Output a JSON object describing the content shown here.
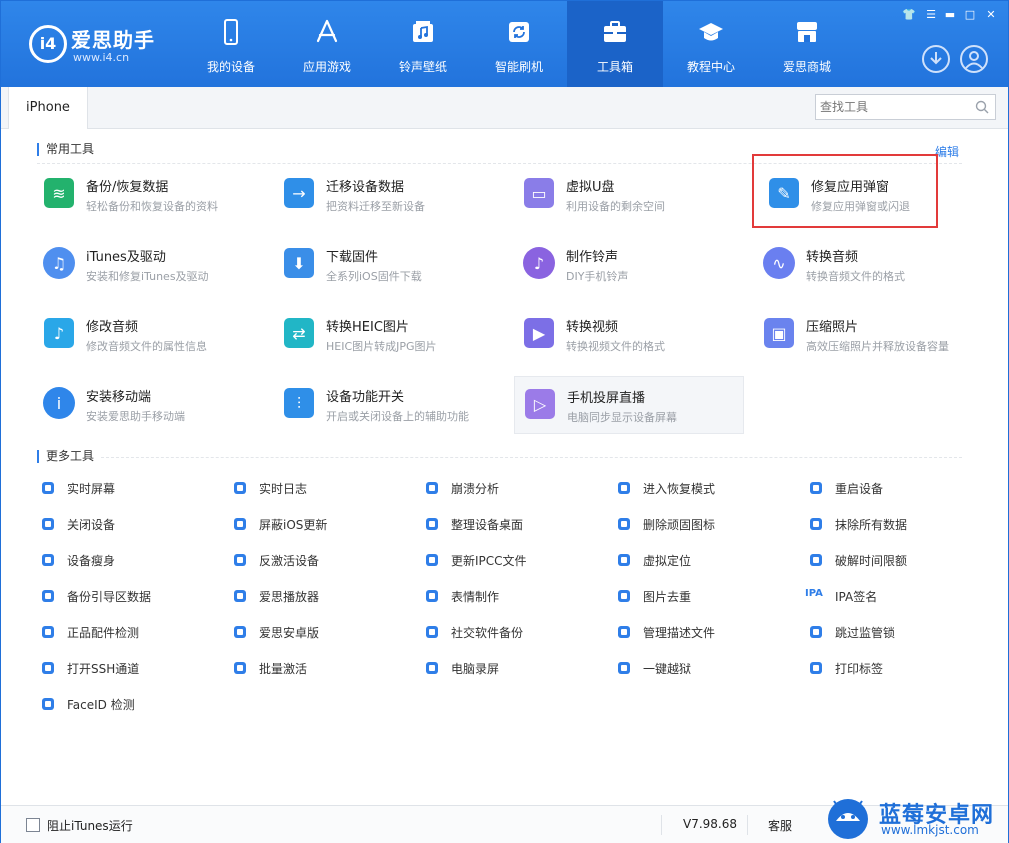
{
  "app": {
    "logo_mark": "i4",
    "name": "爱思助手",
    "url": "www.i4.cn"
  },
  "nav": [
    {
      "label": "我的设备",
      "icon": "phone-icon"
    },
    {
      "label": "应用游戏",
      "icon": "app-store-icon"
    },
    {
      "label": "铃声壁纸",
      "icon": "music-folder-icon"
    },
    {
      "label": "智能刷机",
      "icon": "flash-refresh-icon"
    },
    {
      "label": "工具箱",
      "icon": "toolbox-icon",
      "active": true
    },
    {
      "label": "教程中心",
      "icon": "graduation-cap-icon"
    },
    {
      "label": "爱思商城",
      "icon": "shop-icon"
    }
  ],
  "tabs": [
    {
      "label": "iPhone"
    }
  ],
  "search": {
    "placeholder": "查找工具"
  },
  "sections": {
    "common": {
      "title": "常用工具",
      "edit": "编辑"
    },
    "more": {
      "title": "更多工具"
    }
  },
  "common_tools": [
    {
      "name": "备份/恢复数据",
      "desc": "轻松备份和恢复设备的资料",
      "icon": "layers-backup-icon",
      "color": "#23b26d"
    },
    {
      "name": "迁移设备数据",
      "desc": "把资料迁移至新设备",
      "icon": "migrate-arrow-icon",
      "color": "#2f8fe8"
    },
    {
      "name": "虚拟U盘",
      "desc": "利用设备的剩余空间",
      "icon": "usb-drive-icon",
      "color": "#8a7de8"
    },
    {
      "name": "修复应用弹窗",
      "desc": "修复应用弹窗或闪退",
      "icon": "window-repair-icon",
      "color": "#2f8fe8",
      "selected": true
    },
    {
      "name": "iTunes及驱动",
      "desc": "安装和修复iTunes及驱动",
      "icon": "itunes-icon",
      "color": "#4f8fef"
    },
    {
      "name": "下载固件",
      "desc": "全系列iOS固件下载",
      "icon": "firmware-download-icon",
      "color": "#3a8ee8"
    },
    {
      "name": "制作铃声",
      "desc": "DIY手机铃声",
      "icon": "ringtone-icon",
      "color": "#8a63e0"
    },
    {
      "name": "转换音频",
      "desc": "转换音频文件的格式",
      "icon": "audio-wave-icon",
      "color": "#6a7ff0"
    },
    {
      "name": "修改音频",
      "desc": "修改音频文件的属性信息",
      "icon": "audio-file-icon",
      "color": "#2aa7e8"
    },
    {
      "name": "转换HEIC图片",
      "desc": "HEIC图片转成JPG图片",
      "icon": "heic-convert-icon",
      "color": "#21b6c6"
    },
    {
      "name": "转换视频",
      "desc": "转换视频文件的格式",
      "icon": "video-convert-icon",
      "color": "#7c6fe6"
    },
    {
      "name": "压缩照片",
      "desc": "高效压缩照片并释放设备容量",
      "icon": "photo-compress-icon",
      "color": "#6a83ee"
    },
    {
      "name": "安装移动端",
      "desc": "安装爱思助手移动端",
      "icon": "i4-mobile-icon",
      "color": "#2f86ea"
    },
    {
      "name": "设备功能开关",
      "desc": "开启或关闭设备上的辅助功能",
      "icon": "switch-sliders-icon",
      "color": "#2f8fe8"
    },
    {
      "name": "手机投屏直播",
      "desc": "电脑同步显示设备屏幕",
      "icon": "screen-cast-icon",
      "color": "#9b7be8",
      "hover": true
    }
  ],
  "more_tools": [
    {
      "label": "实时屏幕",
      "icon": "realtime-screen-icon"
    },
    {
      "label": "实时日志",
      "icon": "log-icon"
    },
    {
      "label": "崩溃分析",
      "icon": "crash-analysis-icon"
    },
    {
      "label": "进入恢复模式",
      "icon": "recovery-mode-icon"
    },
    {
      "label": "重启设备",
      "icon": "restart-icon"
    },
    {
      "label": "关闭设备",
      "icon": "power-icon"
    },
    {
      "label": "屏蔽iOS更新",
      "icon": "block-update-icon"
    },
    {
      "label": "整理设备桌面",
      "icon": "desktop-grid-icon"
    },
    {
      "label": "删除顽固图标",
      "icon": "trash-icon"
    },
    {
      "label": "抹除所有数据",
      "icon": "eraser-icon"
    },
    {
      "label": "设备瘦身",
      "icon": "slim-icon"
    },
    {
      "label": "反激活设备",
      "icon": "deactivate-icon"
    },
    {
      "label": "更新IPCC文件",
      "icon": "ipcc-file-icon"
    },
    {
      "label": "虚拟定位",
      "icon": "location-pin-icon"
    },
    {
      "label": "破解时间限额",
      "icon": "clock-icon"
    },
    {
      "label": "备份引导区数据",
      "icon": "boot-backup-icon"
    },
    {
      "label": "爱思播放器",
      "icon": "player-icon"
    },
    {
      "label": "表情制作",
      "icon": "emoji-icon"
    },
    {
      "label": "图片去重",
      "icon": "image-dedupe-icon"
    },
    {
      "label": "IPA签名",
      "icon": "ipa-sign-icon",
      "icon_text": "IPA"
    },
    {
      "label": "正品配件检测",
      "icon": "accessory-check-icon"
    },
    {
      "label": "爱思安卓版",
      "icon": "android-version-icon"
    },
    {
      "label": "社交软件备份",
      "icon": "social-backup-icon"
    },
    {
      "label": "管理描述文件",
      "icon": "profile-manage-icon"
    },
    {
      "label": "跳过监管锁",
      "icon": "shield-lock-icon"
    },
    {
      "label": "打开SSH通道",
      "icon": "ssh-terminal-icon"
    },
    {
      "label": "批量激活",
      "icon": "batch-activate-icon"
    },
    {
      "label": "电脑录屏",
      "icon": "screen-record-icon"
    },
    {
      "label": "一键越狱",
      "icon": "unlock-icon"
    },
    {
      "label": "打印标签",
      "icon": "printer-icon"
    },
    {
      "label": "FaceID 检测",
      "icon": "faceid-icon"
    }
  ],
  "status": {
    "block_itunes": "阻止iTunes运行",
    "block_itunes_checked": false,
    "version": "V7.98.68",
    "service": "客服"
  },
  "watermark": {
    "title": "蓝莓安卓网",
    "url": "www.lmkjst.com"
  },
  "colors": {
    "primary": "#2f7ee8",
    "nav_bg": "#2273dc",
    "nav_active": "#1b63c8",
    "highlight": "#e23a3a"
  }
}
